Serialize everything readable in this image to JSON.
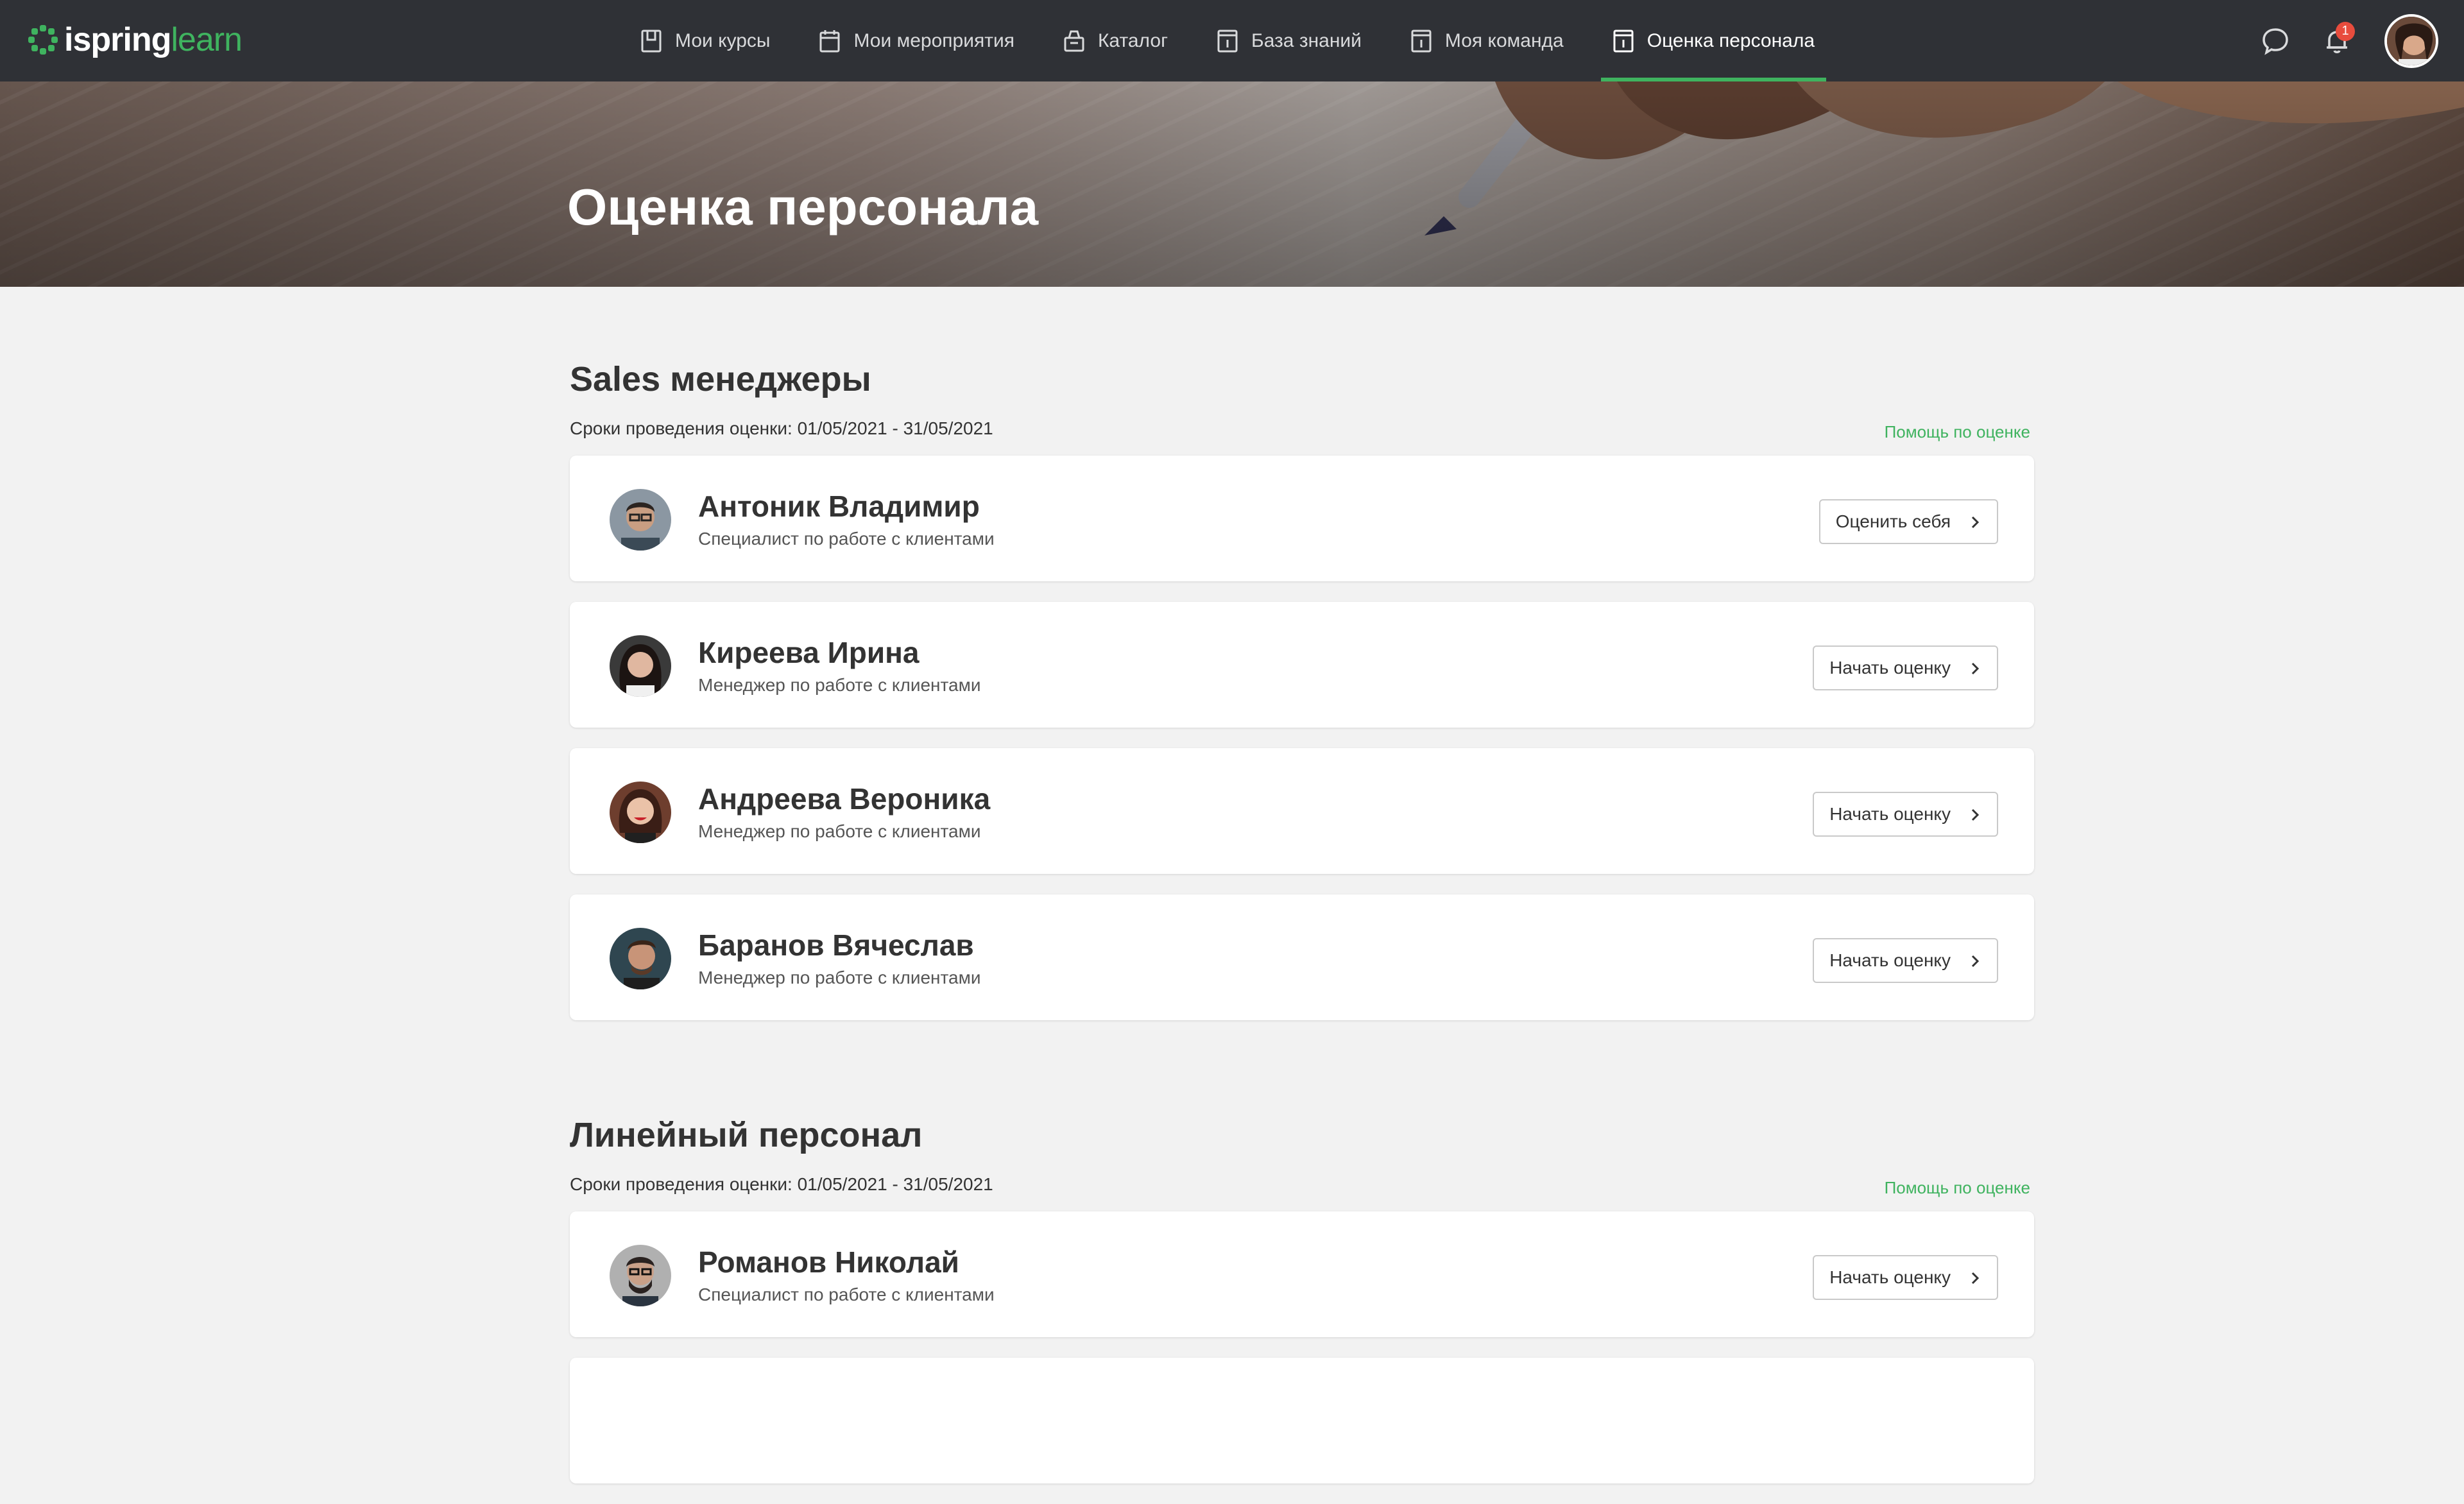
{
  "app": {
    "logo_primary": "ispring",
    "logo_secondary": "learn",
    "brand_color": "#3fb35f"
  },
  "nav": {
    "items": [
      {
        "label": "Мои курсы",
        "icon": "book-icon",
        "active": false
      },
      {
        "label": "Мои мероприятия",
        "icon": "calendar-icon",
        "active": false
      },
      {
        "label": "Каталог",
        "icon": "basket-icon",
        "active": false
      },
      {
        "label": "База знаний",
        "icon": "info-doc-icon",
        "active": false
      },
      {
        "label": "Моя команда",
        "icon": "info-doc-icon",
        "active": false
      },
      {
        "label": "Оценка персонала",
        "icon": "info-doc-icon",
        "active": true
      }
    ]
  },
  "header": {
    "notifications_count": "1"
  },
  "hero": {
    "title": "Оценка персонала"
  },
  "sections": [
    {
      "title": "Sales менеджеры",
      "dates": "Сроки проведения оценки: 01/05/2021 - 31/05/2021",
      "help": "Помощь по оценке",
      "people": [
        {
          "name": "Антоник Владимир",
          "role": "Специалист по работе с клиентами",
          "action": "Оценить себя"
        },
        {
          "name": "Киреева Ирина",
          "role": "Менеджер по работе с клиентами",
          "action": "Начать оценку"
        },
        {
          "name": "Андреева Вероника",
          "role": "Менеджер по работе с клиентами",
          "action": "Начать оценку"
        },
        {
          "name": "Баранов Вячеслав",
          "role": "Менеджер по работе с клиентами",
          "action": "Начать оценку"
        }
      ]
    },
    {
      "title": "Линейный персонал",
      "dates": "Сроки проведения оценки: 01/05/2021 - 31/05/2021",
      "help": "Помощь по оценке",
      "people": [
        {
          "name": "Романов Николай",
          "role": "Специалист по работе с клиентами",
          "action": "Начать оценку"
        }
      ]
    }
  ]
}
